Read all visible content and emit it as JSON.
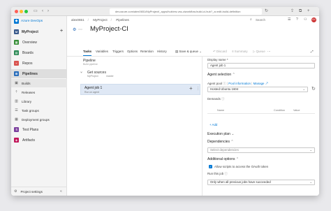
{
  "browser": {
    "url": "dev.azure.com/alex0651/MyProject/_apps/hub/ms.vss-ciworkflow.build-ci-hub?_a=edit-build-definition"
  },
  "sidebar": {
    "org_name": "Azure DevOps",
    "project_name": "MyProject",
    "project_initials": "M",
    "items": [
      {
        "label": "Overview",
        "color": "#3a8f3a",
        "icon": "overview-icon"
      },
      {
        "label": "Boards",
        "color": "#2e8b57",
        "icon": "boards-icon"
      },
      {
        "label": "Repos",
        "color": "#d9534f",
        "icon": "repos-icon"
      },
      {
        "label": "Pipelines",
        "color": "#2a6ebb",
        "icon": "pipelines-icon"
      },
      {
        "label": "Builds",
        "icon": "builds-icon"
      },
      {
        "label": "Releases",
        "icon": "releases-icon"
      },
      {
        "label": "Library",
        "icon": "library-icon"
      },
      {
        "label": "Task groups",
        "icon": "task-groups-icon"
      },
      {
        "label": "Deployment groups",
        "icon": "deployment-groups-icon"
      },
      {
        "label": "Test Plans",
        "color": "#7b3f9e",
        "icon": "test-plans-icon"
      },
      {
        "label": "Artifacts",
        "color": "#c2185b",
        "icon": "artifacts-icon"
      }
    ],
    "settings_label": "Project settings"
  },
  "header": {
    "crumbs": [
      "alex0651",
      "MyProject",
      "Pipelines"
    ],
    "search_placeholder": "Search",
    "avatar": "AX"
  },
  "page": {
    "title": "MyProject-CI"
  },
  "tabs": [
    "Tasks",
    "Variables",
    "Triggers",
    "Options",
    "Retention",
    "History"
  ],
  "toolbar": {
    "save_queue": "Save & queue",
    "discard": "Discard",
    "summary": "Summary",
    "queue": "Queue"
  },
  "pipeline": {
    "title": "Pipeline",
    "subtitle": "Build pipeline",
    "get_sources": "Get sources",
    "repo": "MyProject",
    "branch": "master",
    "job_title": "Agent job 1",
    "job_subtitle": "Run on agent"
  },
  "details": {
    "display_name_label": "Display name *",
    "display_name_value": "Agent job 1",
    "agent_selection": "Agent selection",
    "agent_pool_label": "Agent pool",
    "pool_info": "Pool information",
    "manage": "Manage",
    "agent_pool_value": "Hosted Ubuntu 1604",
    "demands_label": "Demands",
    "col_name": "Name",
    "col_condition": "Condition",
    "col_value": "Value",
    "add": "Add",
    "execution_plan": "Execution plan",
    "dependencies": "Dependencies",
    "dependencies_placeholder": "Select dependencies",
    "additional_options": "Additional options",
    "oauth_label": "Allow scripts to access the OAuth token",
    "run_job_label": "Run this job",
    "run_job_value": "Only when all previous jobs have succeeded"
  }
}
